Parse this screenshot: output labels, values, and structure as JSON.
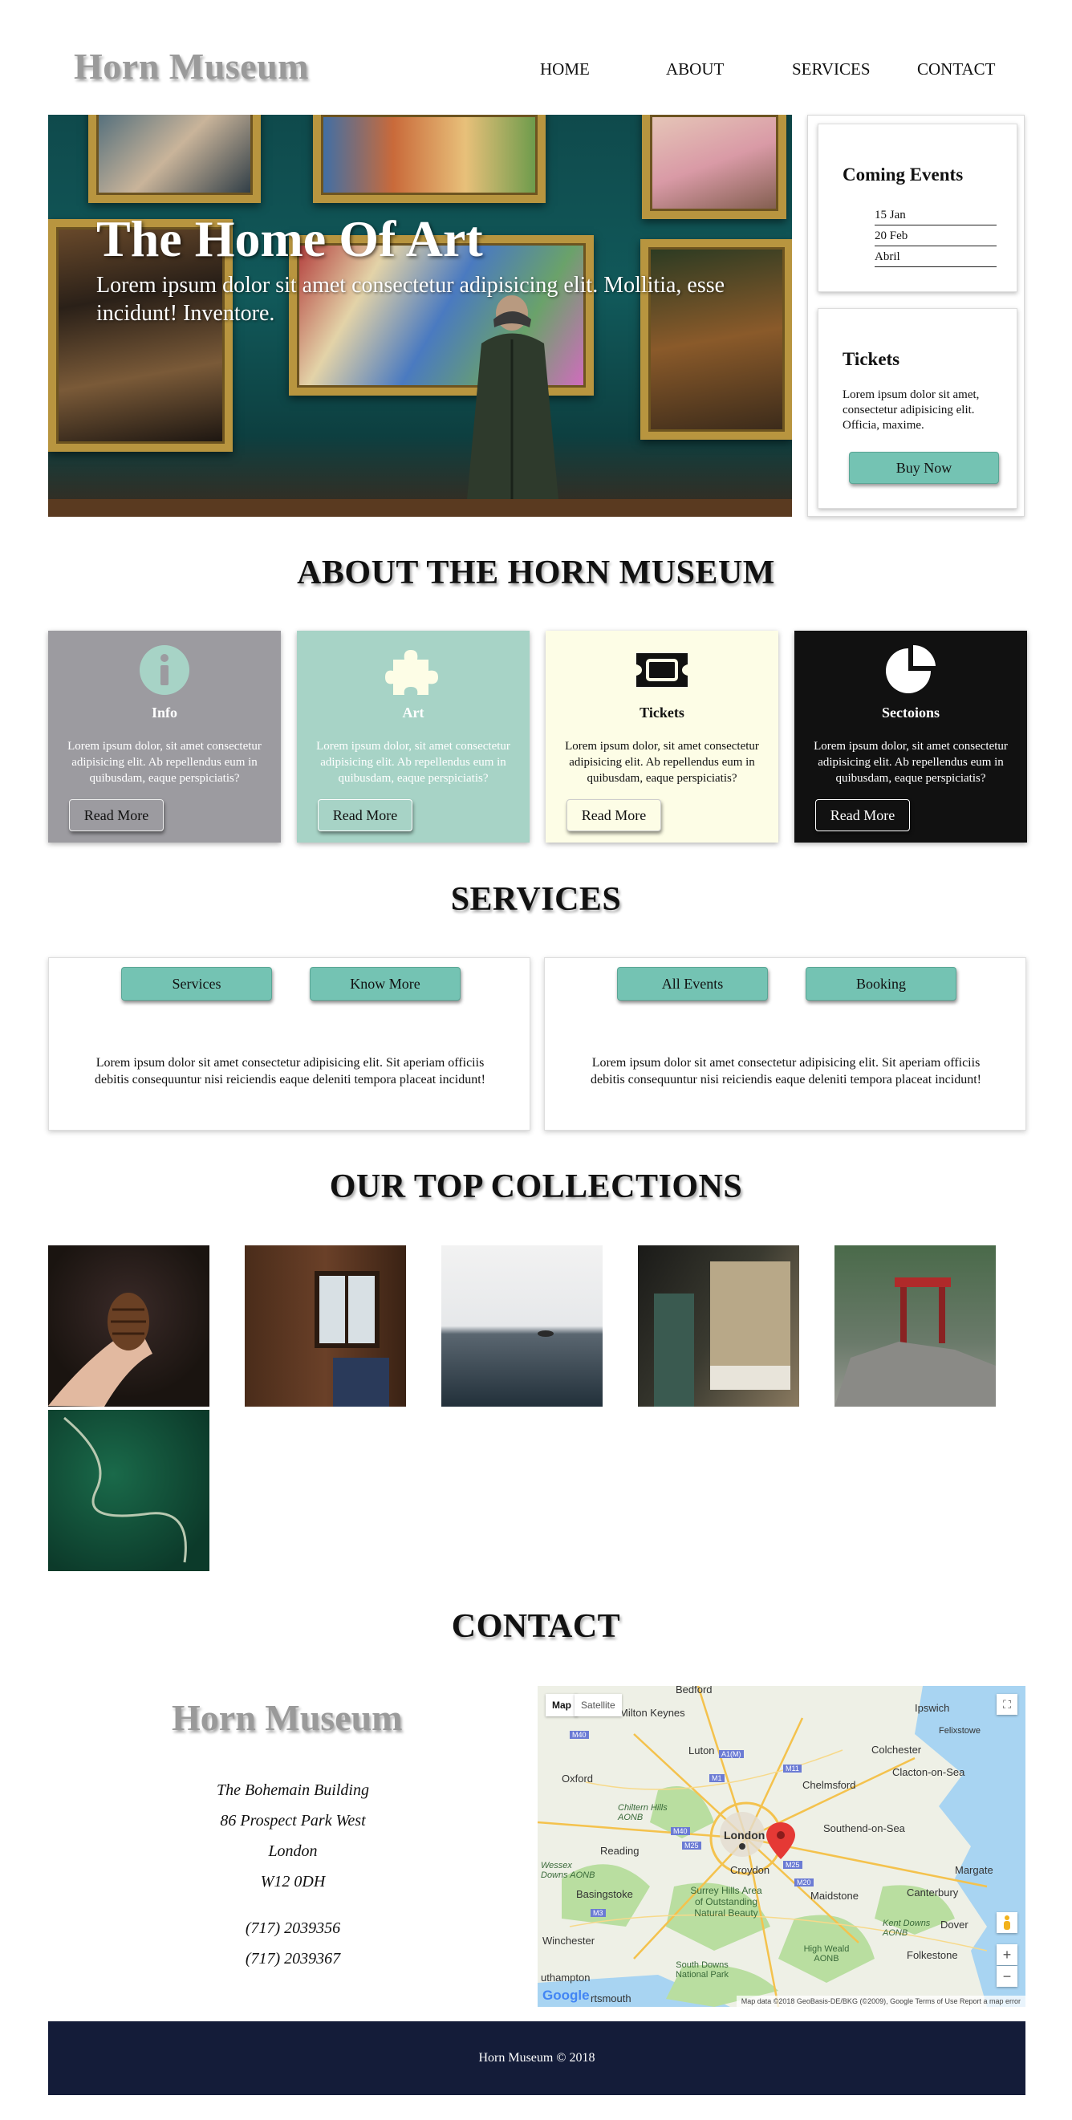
{
  "site": {
    "logo": "Horn Museum"
  },
  "nav": {
    "home": "HOME",
    "about": "ABOUT",
    "services": "SERVICES",
    "contact": "CONTACT"
  },
  "hero": {
    "title": "The Home Of Art",
    "subtitle": "Lorem ipsum dolor sit amet consectetur adipisicing elit. Mollitia, esse incidunt! Inventore."
  },
  "side": {
    "events_title": "Coming Events",
    "events": [
      "15 Jan",
      "20 Feb",
      "Abril"
    ],
    "tickets_title": "Tickets",
    "tickets_text": "Lorem ipsum dolor sit amet, consectetur adipisicing elit. Officia, maxime.",
    "buy_label": "Buy Now"
  },
  "about": {
    "title": "ABOUT THE HORN MUSEUM",
    "cards": [
      {
        "icon": "info-icon",
        "title": "Info",
        "text": "Lorem ipsum dolor, sit amet consectetur adipisicing elit. Ab repellendus eum in quibusdam, eaque perspiciatis?",
        "button": "Read More",
        "bg": "#9c9ba0"
      },
      {
        "icon": "puzzle-icon",
        "title": "Art",
        "text": "Lorem ipsum dolor, sit amet consectetur adipisicing elit. Ab repellendus eum in quibusdam, eaque perspiciatis?",
        "button": "Read More",
        "bg": "#a7d3c6"
      },
      {
        "icon": "ticket-icon",
        "title": "Tickets",
        "text": "Lorem ipsum dolor, sit amet consectetur adipisicing elit. Ab repellendus eum in quibusdam, eaque perspiciatis?",
        "button": "Read More",
        "bg": "#fdfde6"
      },
      {
        "icon": "pie-chart-icon",
        "title": "Sectoions",
        "text": "Lorem ipsum dolor, sit amet consectetur adipisicing elit. Ab repellendus eum in quibusdam, eaque perspiciatis?",
        "button": "Read More",
        "bg": "#111111"
      }
    ]
  },
  "services": {
    "title": "SERVICES",
    "boxes": [
      {
        "btn1": "Services",
        "btn2": "Know More",
        "text": "Lorem ipsum dolor sit amet consectetur adipisicing elit. Sit aperiam officiis debitis consequuntur nisi reiciendis eaque deleniti tempora placeat incidunt!"
      },
      {
        "btn1": "All Events",
        "btn2": "Booking",
        "text": "Lorem ipsum dolor sit amet consectetur adipisicing elit. Sit aperiam officiis debitis consequuntur nisi reiciendis eaque deleniti tempora placeat incidunt!"
      }
    ]
  },
  "collections": {
    "title": "OUR TOP COLLECTIONS"
  },
  "contact": {
    "title": "CONTACT",
    "logo": "Horn Museum",
    "address": [
      "The Bohemain Building",
      "86 Prospect Park West",
      "London",
      "W12 0DH"
    ],
    "phones": [
      "(717) 2039356",
      "(717) 2039367"
    ]
  },
  "map": {
    "tab_map": "Map",
    "tab_satellite": "Satellite",
    "labels": [
      "Bedford",
      "Milton Keynes",
      "Ipswich",
      "Felixstowe",
      "Luton",
      "Colchester",
      "Oxford",
      "Chelmsford",
      "Clacton-on-Sea",
      "Chiltern Hills AONB",
      "London",
      "Southend-on-Sea",
      "Reading",
      "Wessex Downs AONB",
      "Croydon",
      "Margate",
      "Basingstoke",
      "Surrey Hills Area of Outstanding Natural Beauty",
      "Maidstone",
      "Canterbury",
      "Kent Downs AONB",
      "Dover",
      "Winchester",
      "High Weald AONB",
      "Folkestone",
      "South Downs National Park",
      "uthampton",
      "rtsmouth"
    ],
    "roads": [
      "M40",
      "A1(M)",
      "M11",
      "M1",
      "M40",
      "M25",
      "M20",
      "M3",
      "M25"
    ],
    "footer": "Map data ©2018 GeoBasis-DE/BKG (©2009), Google    Terms of Use    Report a map error",
    "google": "Google",
    "zoom_in": "+",
    "zoom_out": "−",
    "fullscreen": "⛶"
  },
  "footer": {
    "text": "Horn Museum © 2018"
  },
  "colors": {
    "accent": "#74c3b3",
    "footer_bg": "#141c39",
    "logo": "#9a9a9a"
  }
}
